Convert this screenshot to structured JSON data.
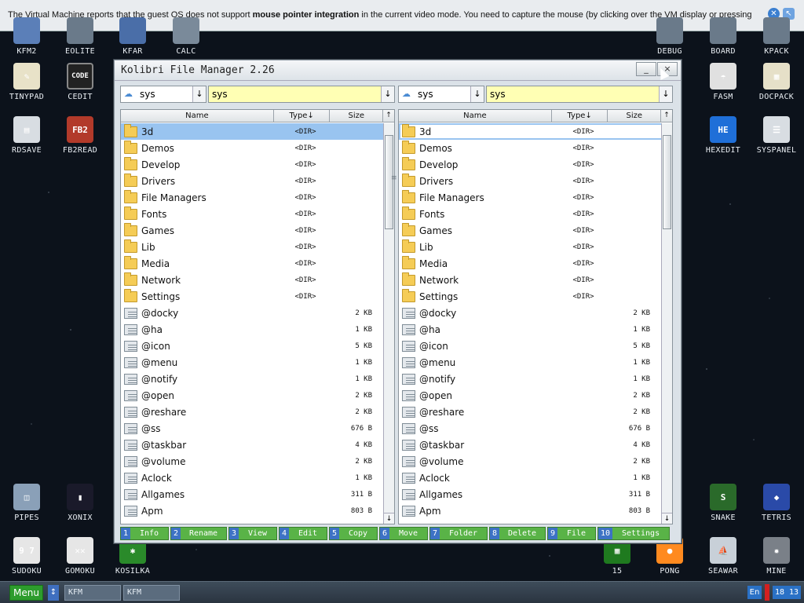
{
  "notification": {
    "prefix": "The Virtual Machine reports that the guest OS does not support ",
    "bold": "mouse pointer integration",
    "suffix": " in the current video mode. You need to capture the mouse (by clicking over the VM display or pressing"
  },
  "desktop": {
    "icons_left": [
      {
        "label": "KFM2",
        "glyph": "",
        "color": "#5b7fb8"
      },
      {
        "label": "EOLITE",
        "glyph": "",
        "color": "#6a7a8a"
      },
      {
        "label": "KFAR",
        "glyph": "",
        "color": "#4a6ea8"
      },
      {
        "label": "CALC",
        "glyph": "",
        "color": "#7a8a9a"
      },
      {
        "label": "TINYPAD",
        "glyph": "✎",
        "color": "#e8e2c8"
      },
      {
        "label": "CEDIT",
        "glyph": "CODE",
        "color": "#222222"
      },
      {
        "label": "RDSAVE",
        "glyph": "▤",
        "color": "#d8dde2"
      },
      {
        "label": "FB2READ",
        "glyph": "FB2",
        "color": "#b23a2a"
      },
      {
        "label": "PIPES",
        "glyph": "◫",
        "color": "#8aa0b8"
      },
      {
        "label": "XONIX",
        "glyph": "▮",
        "color": "#1a1a2a"
      },
      {
        "label": "SUDOKU",
        "glyph": "9 7",
        "color": "#e6e6e6"
      },
      {
        "label": "GOMOKU",
        "glyph": "✕✕",
        "color": "#e6e6e6"
      },
      {
        "label": "KOSILKA",
        "glyph": "✱",
        "color": "#2a8a2a"
      }
    ],
    "icons_right": [
      {
        "label": "DEBUG",
        "glyph": "",
        "color": "#6a7a8a"
      },
      {
        "label": "BOARD",
        "glyph": "",
        "color": "#6a7a8a"
      },
      {
        "label": "KPACK",
        "glyph": "",
        "color": "#6a7a8a"
      },
      {
        "label": "FASM",
        "glyph": "☂",
        "color": "#e0e0e0"
      },
      {
        "label": "DOCPACK",
        "glyph": "▦",
        "color": "#e6e0c8"
      },
      {
        "label": "HEXEDIT",
        "glyph": "HE",
        "color": "#1f6fd8"
      },
      {
        "label": "SYSPANEL",
        "glyph": "☰",
        "color": "#d8dde2"
      },
      {
        "label": "SNAKE",
        "glyph": "S",
        "color": "#2a6a2a"
      },
      {
        "label": "TETRIS",
        "glyph": "◆",
        "color": "#2a4aa8"
      },
      {
        "label": "15",
        "glyph": "▦",
        "color": "#1f7a1f"
      },
      {
        "label": "PONG",
        "glyph": "●",
        "color": "#ff8a1f"
      },
      {
        "label": "SEAWAR",
        "glyph": "⛵",
        "color": "#c8d0d8"
      },
      {
        "label": "MINE",
        "glyph": "✹",
        "color": "#7a8088"
      }
    ]
  },
  "window": {
    "title": "Kolibri File Manager 2.26",
    "minimize": "_",
    "close": "×"
  },
  "left_panel": {
    "drive": "sys",
    "path": "sys",
    "headers": {
      "name": "Name",
      "type": "Type↓",
      "size": "Size",
      "up": "↑"
    },
    "rows": [
      {
        "name": "3d",
        "type": "<DIR>",
        "size": "",
        "kind": "folder",
        "selected": true
      },
      {
        "name": "Demos",
        "type": "<DIR>",
        "size": "",
        "kind": "folder"
      },
      {
        "name": "Develop",
        "type": "<DIR>",
        "size": "",
        "kind": "folder"
      },
      {
        "name": "Drivers",
        "type": "<DIR>",
        "size": "",
        "kind": "folder"
      },
      {
        "name": "File Managers",
        "type": "<DIR>",
        "size": "",
        "kind": "folder"
      },
      {
        "name": "Fonts",
        "type": "<DIR>",
        "size": "",
        "kind": "folder"
      },
      {
        "name": "Games",
        "type": "<DIR>",
        "size": "",
        "kind": "folder"
      },
      {
        "name": "Lib",
        "type": "<DIR>",
        "size": "",
        "kind": "folder"
      },
      {
        "name": "Media",
        "type": "<DIR>",
        "size": "",
        "kind": "folder"
      },
      {
        "name": "Network",
        "type": "<DIR>",
        "size": "",
        "kind": "folder"
      },
      {
        "name": "Settings",
        "type": "<DIR>",
        "size": "",
        "kind": "folder"
      },
      {
        "name": "@docky",
        "type": "",
        "size": "2 KB",
        "kind": "file"
      },
      {
        "name": "@ha",
        "type": "",
        "size": "1 KB",
        "kind": "file"
      },
      {
        "name": "@icon",
        "type": "",
        "size": "5 KB",
        "kind": "file"
      },
      {
        "name": "@menu",
        "type": "",
        "size": "1 KB",
        "kind": "file"
      },
      {
        "name": "@notify",
        "type": "",
        "size": "1 KB",
        "kind": "file"
      },
      {
        "name": "@open",
        "type": "",
        "size": "2 KB",
        "kind": "file"
      },
      {
        "name": "@reshare",
        "type": "",
        "size": "2 KB",
        "kind": "file"
      },
      {
        "name": "@ss",
        "type": "",
        "size": "676 B",
        "kind": "file"
      },
      {
        "name": "@taskbar",
        "type": "",
        "size": "4 KB",
        "kind": "file"
      },
      {
        "name": "@volume",
        "type": "",
        "size": "2 KB",
        "kind": "file"
      },
      {
        "name": "Aclock",
        "type": "",
        "size": "1 KB",
        "kind": "file"
      },
      {
        "name": "Allgames",
        "type": "",
        "size": "311 B",
        "kind": "file"
      },
      {
        "name": "Apm",
        "type": "",
        "size": "803 B",
        "kind": "file"
      }
    ]
  },
  "right_panel": {
    "drive": "sys",
    "path": "sys",
    "headers": {
      "name": "Name",
      "type": "Type↓",
      "size": "Size",
      "up": "↑"
    },
    "rows": [
      {
        "name": "3d",
        "type": "<DIR>",
        "size": "",
        "kind": "folder",
        "cursor": true
      },
      {
        "name": "Demos",
        "type": "<DIR>",
        "size": "",
        "kind": "folder"
      },
      {
        "name": "Develop",
        "type": "<DIR>",
        "size": "",
        "kind": "folder"
      },
      {
        "name": "Drivers",
        "type": "<DIR>",
        "size": "",
        "kind": "folder"
      },
      {
        "name": "File Managers",
        "type": "<DIR>",
        "size": "",
        "kind": "folder"
      },
      {
        "name": "Fonts",
        "type": "<DIR>",
        "size": "",
        "kind": "folder"
      },
      {
        "name": "Games",
        "type": "<DIR>",
        "size": "",
        "kind": "folder"
      },
      {
        "name": "Lib",
        "type": "<DIR>",
        "size": "",
        "kind": "folder"
      },
      {
        "name": "Media",
        "type": "<DIR>",
        "size": "",
        "kind": "folder"
      },
      {
        "name": "Network",
        "type": "<DIR>",
        "size": "",
        "kind": "folder"
      },
      {
        "name": "Settings",
        "type": "<DIR>",
        "size": "",
        "kind": "folder"
      },
      {
        "name": "@docky",
        "type": "",
        "size": "2 KB",
        "kind": "file"
      },
      {
        "name": "@ha",
        "type": "",
        "size": "1 KB",
        "kind": "file"
      },
      {
        "name": "@icon",
        "type": "",
        "size": "5 KB",
        "kind": "file"
      },
      {
        "name": "@menu",
        "type": "",
        "size": "1 KB",
        "kind": "file"
      },
      {
        "name": "@notify",
        "type": "",
        "size": "1 KB",
        "kind": "file"
      },
      {
        "name": "@open",
        "type": "",
        "size": "2 KB",
        "kind": "file"
      },
      {
        "name": "@reshare",
        "type": "",
        "size": "2 KB",
        "kind": "file"
      },
      {
        "name": "@ss",
        "type": "",
        "size": "676 B",
        "kind": "file"
      },
      {
        "name": "@taskbar",
        "type": "",
        "size": "4 KB",
        "kind": "file"
      },
      {
        "name": "@volume",
        "type": "",
        "size": "2 KB",
        "kind": "file"
      },
      {
        "name": "Aclock",
        "type": "",
        "size": "1 KB",
        "kind": "file"
      },
      {
        "name": "Allgames",
        "type": "",
        "size": "311 B",
        "kind": "file"
      },
      {
        "name": "Apm",
        "type": "",
        "size": "803 B",
        "kind": "file"
      }
    ]
  },
  "function_keys": [
    {
      "num": "1",
      "label": "Info"
    },
    {
      "num": "2",
      "label": "Rename"
    },
    {
      "num": "3",
      "label": "View"
    },
    {
      "num": "4",
      "label": "Edit"
    },
    {
      "num": "5",
      "label": "Copy"
    },
    {
      "num": "6",
      "label": "Move"
    },
    {
      "num": "7",
      "label": "Folder"
    },
    {
      "num": "8",
      "label": "Delete"
    },
    {
      "num": "9",
      "label": "File"
    },
    {
      "num": "10",
      "label": "Settings"
    }
  ],
  "taskbar": {
    "menu": "Menu",
    "arrow": "↕",
    "tasks": [
      "KFM",
      "KFM"
    ],
    "lang": "En",
    "time": "18 13"
  },
  "colors": {
    "desktop_bg": "#0c121b",
    "selection": "#99c4f0",
    "path_bg": "#ffffb4",
    "fkey_bg": "#59b347",
    "fkey_num_bg": "#3d72c5",
    "menu_bg": "#2d9c2d"
  }
}
